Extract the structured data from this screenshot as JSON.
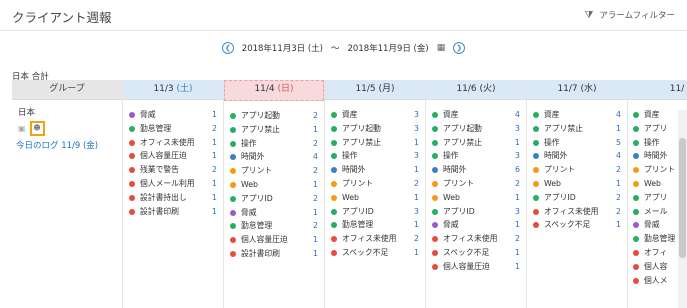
{
  "header": {
    "title": "クライアント週報",
    "alarm_filter_label": "アラームフィルター"
  },
  "date_nav": {
    "start": "2018年11月3日 (土)",
    "separator": "～",
    "end": "2018年11月9日 (金)"
  },
  "scope_label": "日本 合計",
  "group": {
    "header": "グループ",
    "name": "日本",
    "log_link": "今日のログ 11/9 (金)"
  },
  "days": [
    {
      "date": "11/3",
      "weekday": "(土)",
      "items": [
        {
          "label": "脅威",
          "count": "1",
          "color": "#9b59d0"
        },
        {
          "label": "勤怠管理",
          "count": "2",
          "color": "#27ae60"
        },
        {
          "label": "オフィス未使用",
          "count": "1",
          "color": "#e74c3c"
        },
        {
          "label": "個人容量圧迫",
          "count": "1",
          "color": "#e74c3c"
        },
        {
          "label": "残業で警告",
          "count": "2",
          "color": "#e74c3c"
        },
        {
          "label": "個人メール利用",
          "count": "1",
          "color": "#e74c3c"
        },
        {
          "label": "設計書持出し",
          "count": "1",
          "color": "#e74c3c"
        },
        {
          "label": "設計書印刷",
          "count": "1",
          "color": "#e74c3c"
        }
      ]
    },
    {
      "date": "11/4",
      "weekday": "(日)",
      "items": [
        {
          "label": "アプリ起動",
          "count": "2",
          "color": "#27ae60"
        },
        {
          "label": "アプリ禁止",
          "count": "1",
          "color": "#27ae60"
        },
        {
          "label": "操作",
          "count": "2",
          "color": "#27ae60"
        },
        {
          "label": "時間外",
          "count": "4",
          "color": "#3b7fc4"
        },
        {
          "label": "プリント",
          "count": "2",
          "color": "#f39c12"
        },
        {
          "label": "Web",
          "count": "1",
          "color": "#f39c12"
        },
        {
          "label": "アプリID",
          "count": "2",
          "color": "#27ae60"
        },
        {
          "label": "脅威",
          "count": "1",
          "color": "#9b59d0"
        },
        {
          "label": "勤怠管理",
          "count": "2",
          "color": "#27ae60"
        },
        {
          "label": "個人容量圧迫",
          "count": "1",
          "color": "#e74c3c"
        },
        {
          "label": "設計書印刷",
          "count": "1",
          "color": "#e74c3c"
        }
      ]
    },
    {
      "date": "11/5",
      "weekday": "(月)",
      "items": [
        {
          "label": "資産",
          "count": "3",
          "color": "#27ae60"
        },
        {
          "label": "アプリ起動",
          "count": "3",
          "color": "#27ae60"
        },
        {
          "label": "アプリ禁止",
          "count": "1",
          "color": "#27ae60"
        },
        {
          "label": "操作",
          "count": "3",
          "color": "#27ae60"
        },
        {
          "label": "時間外",
          "count": "1",
          "color": "#3b7fc4"
        },
        {
          "label": "プリント",
          "count": "2",
          "color": "#f39c12"
        },
        {
          "label": "Web",
          "count": "1",
          "color": "#f39c12"
        },
        {
          "label": "アプリID",
          "count": "3",
          "color": "#27ae60"
        },
        {
          "label": "勤怠管理",
          "count": "1",
          "color": "#27ae60"
        },
        {
          "label": "オフィス未使用",
          "count": "2",
          "color": "#e74c3c"
        },
        {
          "label": "スペック不足",
          "count": "1",
          "color": "#e74c3c"
        }
      ]
    },
    {
      "date": "11/6",
      "weekday": "(火)",
      "items": [
        {
          "label": "資産",
          "count": "4",
          "color": "#27ae60"
        },
        {
          "label": "アプリ起動",
          "count": "3",
          "color": "#27ae60"
        },
        {
          "label": "アプリ禁止",
          "count": "1",
          "color": "#27ae60"
        },
        {
          "label": "操作",
          "count": "3",
          "color": "#27ae60"
        },
        {
          "label": "時間外",
          "count": "6",
          "color": "#3b7fc4"
        },
        {
          "label": "プリント",
          "count": "2",
          "color": "#f39c12"
        },
        {
          "label": "Web",
          "count": "1",
          "color": "#f39c12"
        },
        {
          "label": "アプリID",
          "count": "3",
          "color": "#27ae60"
        },
        {
          "label": "脅威",
          "count": "1",
          "color": "#9b59d0"
        },
        {
          "label": "オフィス未使用",
          "count": "2",
          "color": "#e74c3c"
        },
        {
          "label": "スペック不足",
          "count": "1",
          "color": "#e74c3c"
        },
        {
          "label": "個人容量圧迫",
          "count": "1",
          "color": "#e74c3c"
        }
      ]
    },
    {
      "date": "11/7",
      "weekday": "(水)",
      "items": [
        {
          "label": "資産",
          "count": "4",
          "color": "#27ae60"
        },
        {
          "label": "アプリ禁止",
          "count": "1",
          "color": "#27ae60"
        },
        {
          "label": "操作",
          "count": "5",
          "color": "#27ae60"
        },
        {
          "label": "時間外",
          "count": "4",
          "color": "#3b7fc4"
        },
        {
          "label": "プリント",
          "count": "2",
          "color": "#f39c12"
        },
        {
          "label": "Web",
          "count": "1",
          "color": "#f39c12"
        },
        {
          "label": "アプリID",
          "count": "2",
          "color": "#27ae60"
        },
        {
          "label": "オフィス未使用",
          "count": "2",
          "color": "#e74c3c"
        },
        {
          "label": "スペック不足",
          "count": "1",
          "color": "#e74c3c"
        }
      ]
    },
    {
      "date": "11/",
      "weekday": "",
      "items": [
        {
          "label": "資産",
          "count": "",
          "color": "#27ae60"
        },
        {
          "label": "アプリ",
          "count": "",
          "color": "#27ae60"
        },
        {
          "label": "操作",
          "count": "",
          "color": "#27ae60"
        },
        {
          "label": "時間外",
          "count": "",
          "color": "#3b7fc4"
        },
        {
          "label": "プリント",
          "count": "",
          "color": "#f39c12"
        },
        {
          "label": "Web",
          "count": "",
          "color": "#f39c12"
        },
        {
          "label": "アプリ",
          "count": "",
          "color": "#27ae60"
        },
        {
          "label": "メール",
          "count": "",
          "color": "#27ae60"
        },
        {
          "label": "脅威",
          "count": "",
          "color": "#9b59d0"
        },
        {
          "label": "勤怠管理",
          "count": "",
          "color": "#27ae60"
        },
        {
          "label": "オフィ",
          "count": "",
          "color": "#e74c3c"
        },
        {
          "label": "個人容",
          "count": "",
          "color": "#e74c3c"
        },
        {
          "label": "個人メ",
          "count": "",
          "color": "#e74c3c"
        }
      ]
    }
  ]
}
